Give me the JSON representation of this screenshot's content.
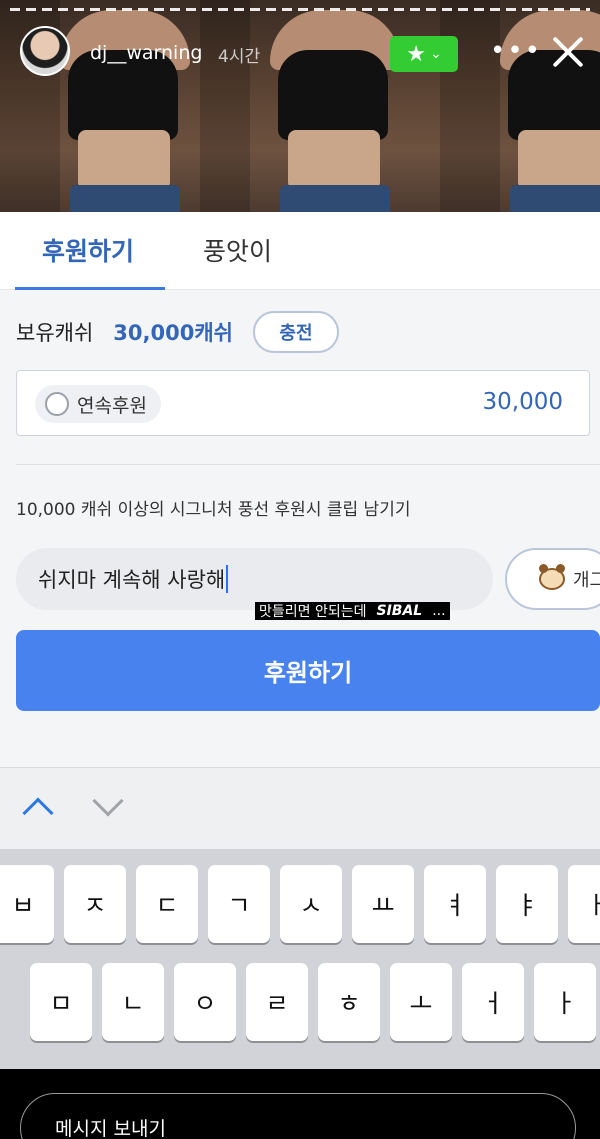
{
  "story": {
    "username": "dj__warning",
    "time": "4시간",
    "star_icon": "★",
    "chevron": "⌄"
  },
  "tabs": [
    {
      "label": "후원하기",
      "active": true
    },
    {
      "label": "풍앗이",
      "active": false
    }
  ],
  "cash": {
    "label": "보유캐쉬",
    "amount": "30,000캐쉬",
    "charge_label": "충전"
  },
  "donation": {
    "recurring_label": "연속후원",
    "amount": "30,000"
  },
  "clip_note": "10,000 캐쉬 이상의 시그니처 풍선 후원시 클립 남기기",
  "message": {
    "value": "쉬지마 계속해 사랑해",
    "emote_label": "개그"
  },
  "caption": {
    "text": "맛들리면 안되는데",
    "english": "SIBAL",
    "ellipsis": "..."
  },
  "donate_button": "후원하기",
  "keyboard": {
    "row1": [
      "ㅂ",
      "ㅈ",
      "ㄷ",
      "ㄱ",
      "ㅅ",
      "ㅛ",
      "ㅕ",
      "ㅑ",
      "ㅐ"
    ],
    "row2": [
      "ㅁ",
      "ㄴ",
      "ㅇ",
      "ㄹ",
      "ㅎ",
      "ㅗ",
      "ㅓ",
      "ㅏ"
    ]
  },
  "reply_placeholder": "메시지 보내기",
  "colors": {
    "accent": "#3466b8",
    "button": "#4782ef",
    "badge_green": "#33cc33"
  }
}
